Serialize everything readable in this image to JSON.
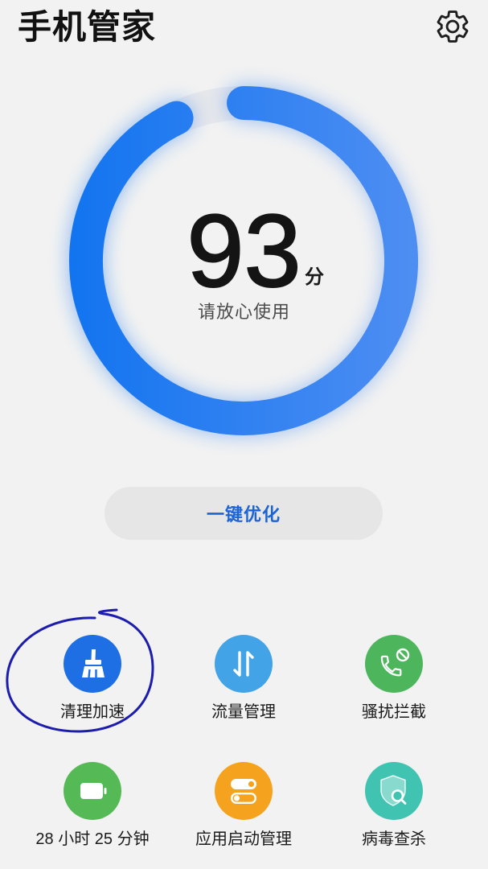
{
  "header": {
    "title": "手机管家",
    "settings_icon": "gear-icon"
  },
  "score": {
    "value": 93,
    "unit": "分",
    "status": "请放心使用",
    "ring_fill": 0.93
  },
  "optimize_button": {
    "label": "一键优化"
  },
  "tools": [
    {
      "label": "清理加速",
      "icon": "broom-icon",
      "color": "#1e6fe3"
    },
    {
      "label": "流量管理",
      "icon": "data-traffic-icon",
      "color": "#42a3e7"
    },
    {
      "label": "骚扰拦截",
      "icon": "call-block-icon",
      "color": "#4db65d"
    },
    {
      "label": "28 小时 25 分钟",
      "icon": "battery-icon",
      "color": "#55b956"
    },
    {
      "label": "应用启动管理",
      "icon": "app-launch-icon",
      "color": "#f5a31f"
    },
    {
      "label": "病毒查杀",
      "icon": "virus-scan-icon",
      "color": "#40c3b1"
    }
  ],
  "colors": {
    "background": "#f2f2f2",
    "ring_start": "#1274f0",
    "ring_end": "#4e8ef2",
    "ring_track": "#e6e7eb",
    "accent_text": "#1c64d6",
    "annotation": "#1c1cad"
  }
}
